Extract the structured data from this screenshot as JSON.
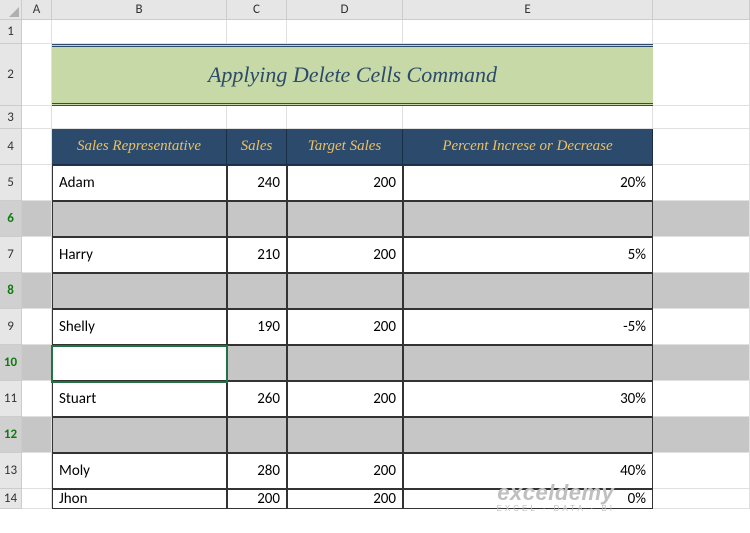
{
  "columns": [
    "A",
    "B",
    "C",
    "D",
    "E"
  ],
  "row_numbers": [
    1,
    2,
    3,
    4,
    5,
    6,
    7,
    8,
    9,
    10,
    11,
    12,
    13,
    14
  ],
  "title": "Applying Delete Cells Command",
  "headers": {
    "rep": "Sales Representative",
    "sales": "Sales",
    "target": "Target Sales",
    "percent": "Percent Increse or Decrease"
  },
  "chart_data": {
    "type": "table",
    "columns": [
      "Sales Representative",
      "Sales",
      "Target Sales",
      "Percent Increse or Decrease"
    ],
    "rows": [
      {
        "rep": "Adam",
        "sales": 240,
        "target": 200,
        "percent": "20%"
      },
      {
        "rep": "Harry",
        "sales": 210,
        "target": 200,
        "percent": "5%"
      },
      {
        "rep": "Shelly",
        "sales": 190,
        "target": 200,
        "percent": "-5%"
      },
      {
        "rep": "Stuart",
        "sales": 260,
        "target": 200,
        "percent": "30%"
      },
      {
        "rep": "Moly",
        "sales": 280,
        "target": 200,
        "percent": "40%"
      },
      {
        "rep": "Jhon",
        "sales": 200,
        "target": 200,
        "percent": "0%"
      }
    ]
  },
  "selected_rows": [
    6,
    8,
    10,
    12
  ],
  "active_cell": "B10",
  "watermark": {
    "main": "exceldemy",
    "sub": "EXCEL · DATA · BI"
  }
}
